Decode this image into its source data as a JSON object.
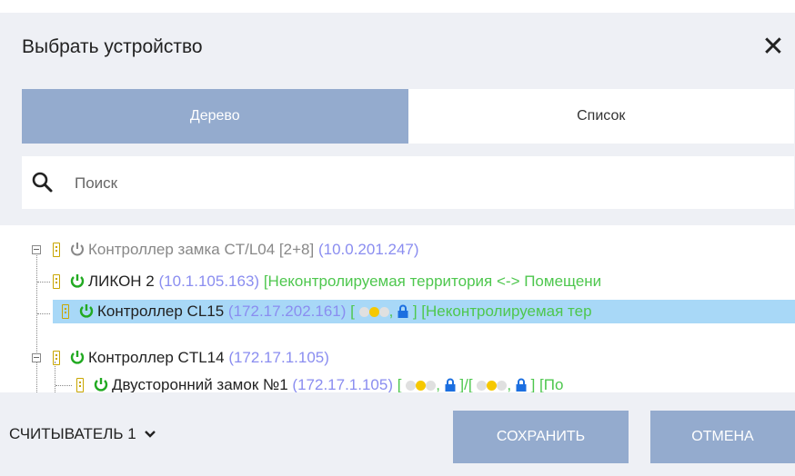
{
  "dialog": {
    "title": "Выбрать устройство",
    "close_label": "✕"
  },
  "tabs": [
    {
      "label": "Дерево",
      "active": true
    },
    {
      "label": "Список",
      "active": false
    }
  ],
  "search": {
    "placeholder": "Поиск",
    "value": ""
  },
  "tree": [
    {
      "name": "Контроллер замка CT/L04 [2+8]",
      "ip": "(10.0.201.247)",
      "zone": "",
      "power": "gray",
      "state": "offline"
    },
    {
      "name": "ЛИКОН 2",
      "ip": "(10.1.105.163)",
      "zone": "[Неконтролируемая территория <-> Помещени",
      "power": "green",
      "state": "online"
    },
    {
      "name": "Контроллер CL15",
      "ip": "(172.17.202.161)",
      "zone": "[Неконтролируемая тер",
      "power": "green",
      "state": "online",
      "selected": true,
      "open_bracket": "[",
      "sep": ",",
      "close_bracket": "]"
    },
    {
      "name": "Контроллер CTL14",
      "ip": "(172.17.1.105)",
      "zone": "",
      "power": "green",
      "state": "online"
    },
    {
      "name": "Двусторонний замок №1",
      "ip": "(172.17.1.105)",
      "zone": "[По",
      "power": "green",
      "state": "online",
      "open_bracket": "[",
      "sep": ",",
      "close_bracket": "]",
      "slash": "/"
    }
  ],
  "colors": {
    "accent": "#94abce",
    "selected_row": "#a8d8f7",
    "ip": "#8a8df0",
    "zone": "#4ec74e",
    "power_on": "#22aa22"
  },
  "footer": {
    "reader_label": "СЧИТЫВАТЕЛЬ 1",
    "save_label": "СОХРАНИТЬ",
    "cancel_label": "ОТМЕНА"
  }
}
